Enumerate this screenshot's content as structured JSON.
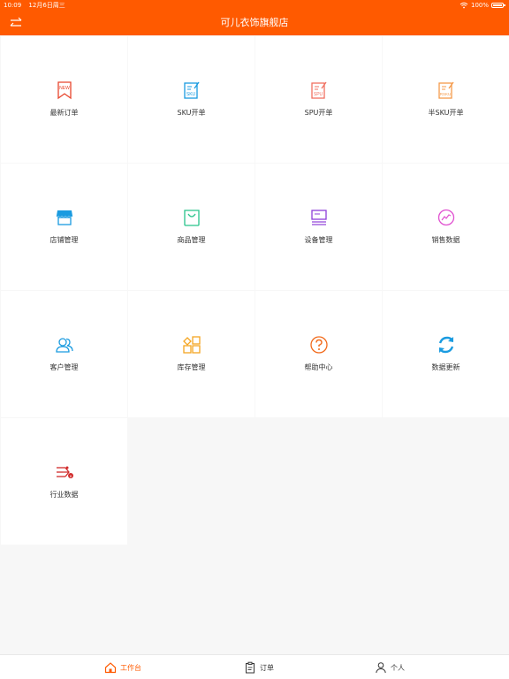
{
  "status_bar": {
    "time": "10:09",
    "date": "12月6日周三",
    "battery": "100%",
    "battery_level": 1.0
  },
  "header": {
    "title": "可儿衣饰旗舰店",
    "switch_icon": "swap-icon"
  },
  "grid": {
    "items": [
      {
        "label": "最新订单",
        "icon": "new-order-icon",
        "color": "#e8452c"
      },
      {
        "label": "SKU开单",
        "icon": "sku-order-icon",
        "color": "#1a9be0"
      },
      {
        "label": "SPU开单",
        "icon": "spu-order-icon",
        "color": "#f07060"
      },
      {
        "label": "半SKU开单",
        "icon": "half-sku-order-icon",
        "color": "#f59a4a"
      },
      {
        "label": "店铺管理",
        "icon": "store-icon",
        "color": "#1a9be0"
      },
      {
        "label": "商品管理",
        "icon": "shopping-bag-icon",
        "color": "#28c48b"
      },
      {
        "label": "设备管理",
        "icon": "device-icon",
        "color": "#8e3fd8"
      },
      {
        "label": "销售数据",
        "icon": "sales-chart-icon",
        "color": "#e04fd0"
      },
      {
        "label": "客户管理",
        "icon": "customers-icon",
        "color": "#1a9be0"
      },
      {
        "label": "库存管理",
        "icon": "inventory-icon",
        "color": "#f5a623"
      },
      {
        "label": "帮助中心",
        "icon": "help-icon",
        "color": "#f26a1b"
      },
      {
        "label": "数据更新",
        "icon": "refresh-icon",
        "color": "#1a9be0"
      },
      {
        "label": "行业数据",
        "icon": "industry-data-icon",
        "color": "#d12a2a"
      }
    ]
  },
  "tabbar": {
    "tabs": [
      {
        "label": "工作台",
        "icon": "home-icon",
        "active": true
      },
      {
        "label": "订单",
        "icon": "clipboard-icon",
        "active": false
      },
      {
        "label": "个人",
        "icon": "person-icon",
        "active": false
      }
    ]
  },
  "colors": {
    "brand": "#ff5a00",
    "background": "#f7f7f7"
  }
}
